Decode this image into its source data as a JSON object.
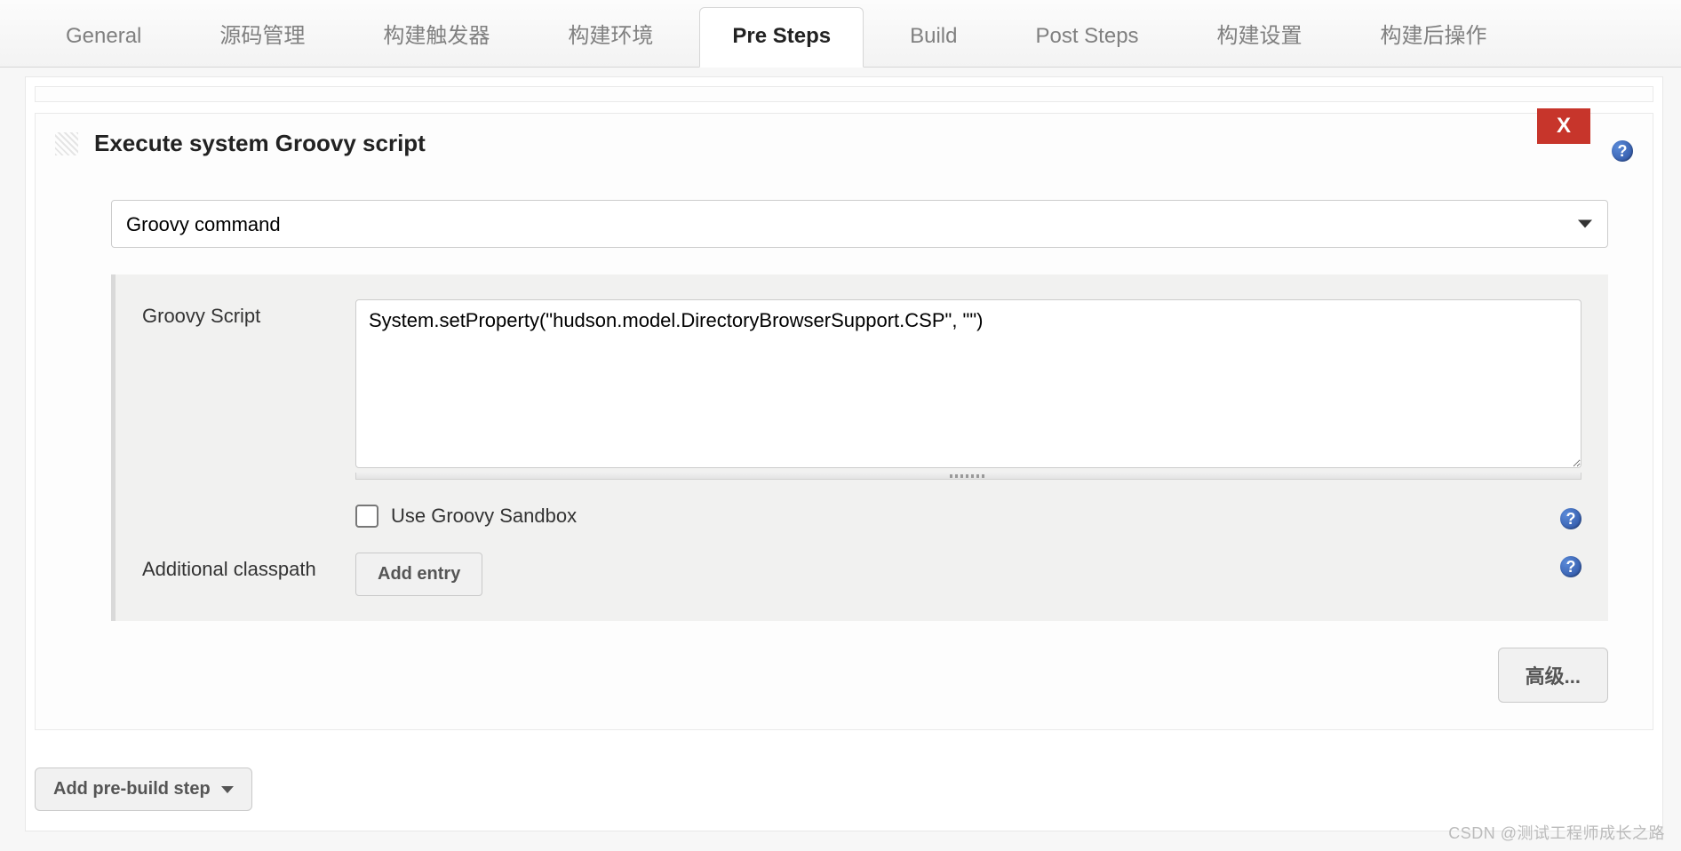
{
  "tabs": {
    "general": "General",
    "scm": "源码管理",
    "triggers": "构建触发器",
    "env": "构建环境",
    "pre": "Pre Steps",
    "build": "Build",
    "post": "Post Steps",
    "settings": "构建设置",
    "post_build": "构建后操作"
  },
  "step": {
    "title": "Execute system Groovy script",
    "delete_label": "X",
    "help_glyph": "?",
    "type_select": "Groovy command",
    "script_label": "Groovy Script",
    "script_value": "System.setProperty(\"hudson.model.DirectoryBrowserSupport.CSP\", \"\")",
    "sandbox_label": "Use Groovy Sandbox",
    "classpath_label": "Additional classpath",
    "add_entry_label": "Add entry",
    "advanced_label": "高级..."
  },
  "bottom": {
    "add_step_label": "Add pre-build step"
  },
  "watermark": "CSDN @测试工程师成长之路"
}
